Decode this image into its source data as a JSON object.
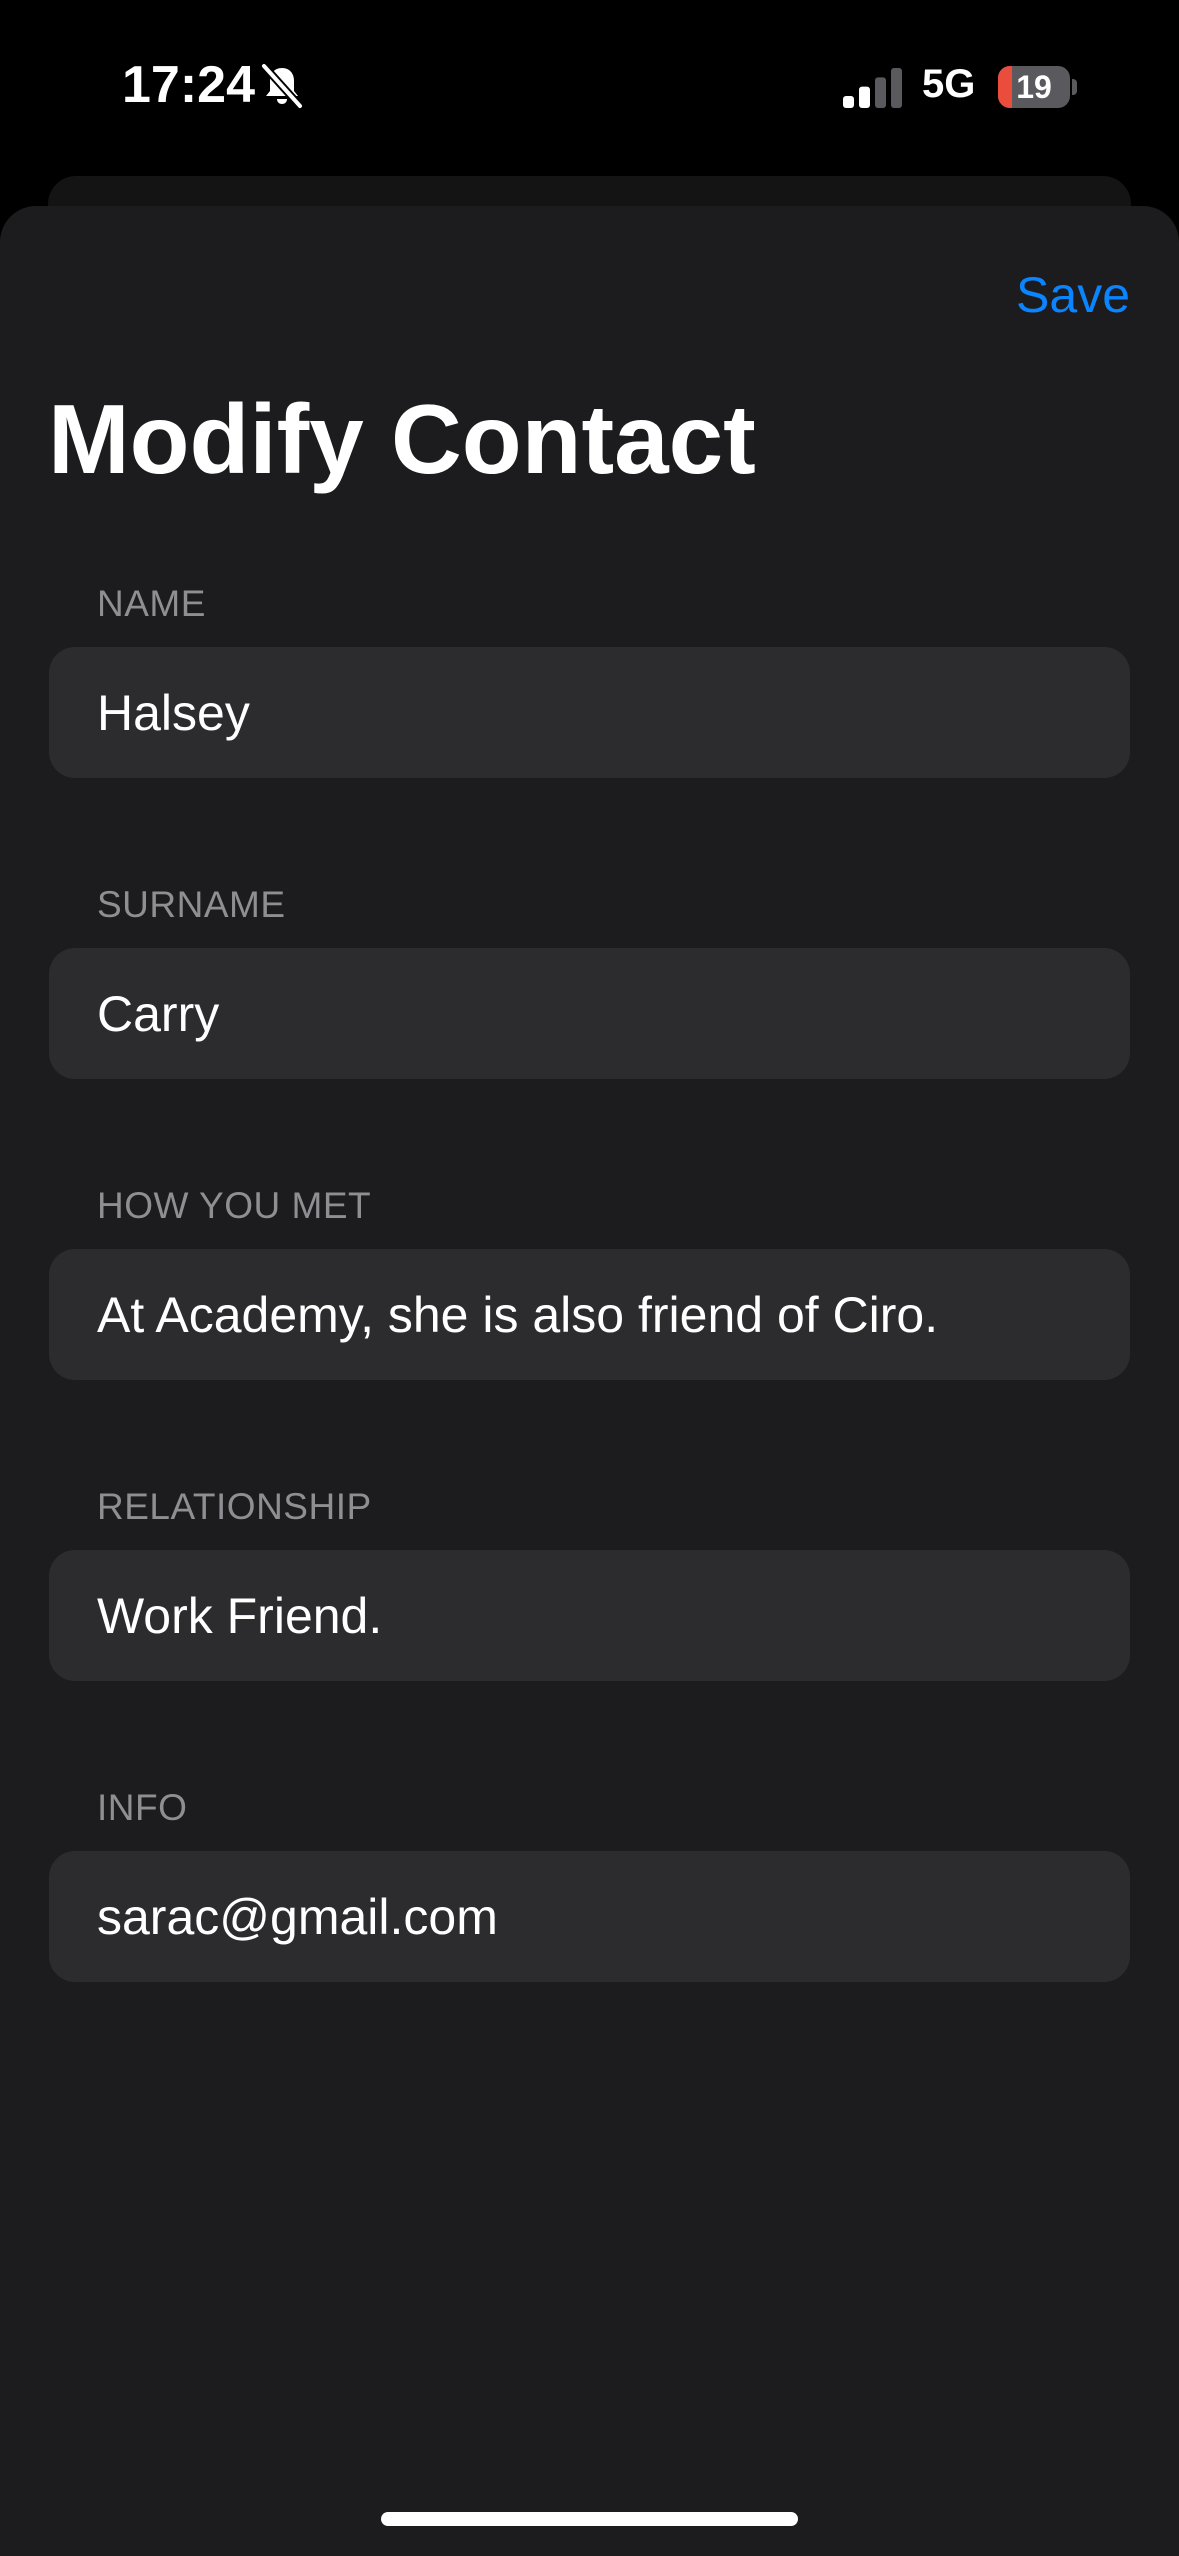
{
  "status_bar": {
    "time": "17:24",
    "network": "5G",
    "battery_level": "19",
    "battery_fraction": 0.19,
    "signal_bars_active": 2,
    "signal_bars_total": 4,
    "silent_icon": "bell-slash-icon"
  },
  "header": {
    "save_label": "Save",
    "title": "Modify Contact"
  },
  "form": {
    "fields": [
      {
        "label": "NAME",
        "value": "Halsey"
      },
      {
        "label": "SURNAME",
        "value": "Carry"
      },
      {
        "label": "HOW YOU MET",
        "value": "At Academy, she is also friend of Ciro."
      },
      {
        "label": "RELATIONSHIP",
        "value": "Work Friend."
      },
      {
        "label": "INFO",
        "value": "sarac@gmail.com"
      }
    ]
  },
  "colors": {
    "background": "#000000",
    "sheet": "#1c1c1e",
    "field": "#2c2c2e",
    "accent": "#0a84ff",
    "label": "#8e8e93",
    "battery_low": "#eb4d3d"
  }
}
